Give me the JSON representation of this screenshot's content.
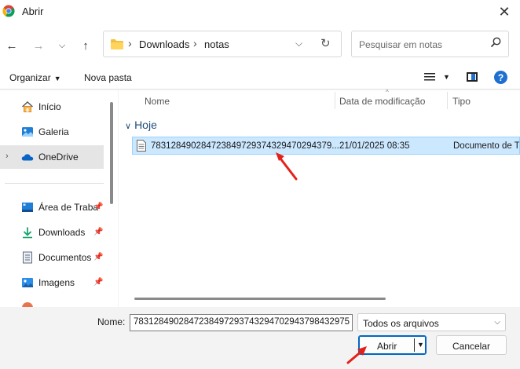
{
  "window": {
    "title": "Abrir"
  },
  "address": {
    "crumbs": [
      "Downloads",
      "notas"
    ]
  },
  "search": {
    "placeholder": "Pesquisar em notas"
  },
  "toolbar": {
    "organize": "Organizar",
    "new_folder": "Nova pasta"
  },
  "sidebar": {
    "items": [
      {
        "label": "Início",
        "icon": "home-icon"
      },
      {
        "label": "Galeria",
        "icon": "gallery-icon"
      },
      {
        "label": "OneDrive",
        "icon": "cloud-icon"
      },
      {
        "label": "Área de Traba",
        "icon": "desktop-icon"
      },
      {
        "label": "Downloads",
        "icon": "download-icon"
      },
      {
        "label": "Documentos",
        "icon": "document-icon"
      },
      {
        "label": "Imagens",
        "icon": "image-icon"
      }
    ]
  },
  "columns": {
    "name": "Nome",
    "date": "Data de modificação",
    "type": "Tipo"
  },
  "group": {
    "label": "Hoje"
  },
  "files": [
    {
      "name": "783128490284723849729374329470294379...",
      "date": "21/01/2025 08:35",
      "type": "Documento de T"
    }
  ],
  "footer": {
    "name_label": "Nome:",
    "name_value": "7831284902847238497293743294702943798432975",
    "file_type": "Todos os arquivos",
    "open_label": "Abrir",
    "cancel_label": "Cancelar"
  },
  "colors": {
    "accent": "#0067c0",
    "selection": "#cce8ff",
    "annotation_arrow": "#e32119"
  }
}
